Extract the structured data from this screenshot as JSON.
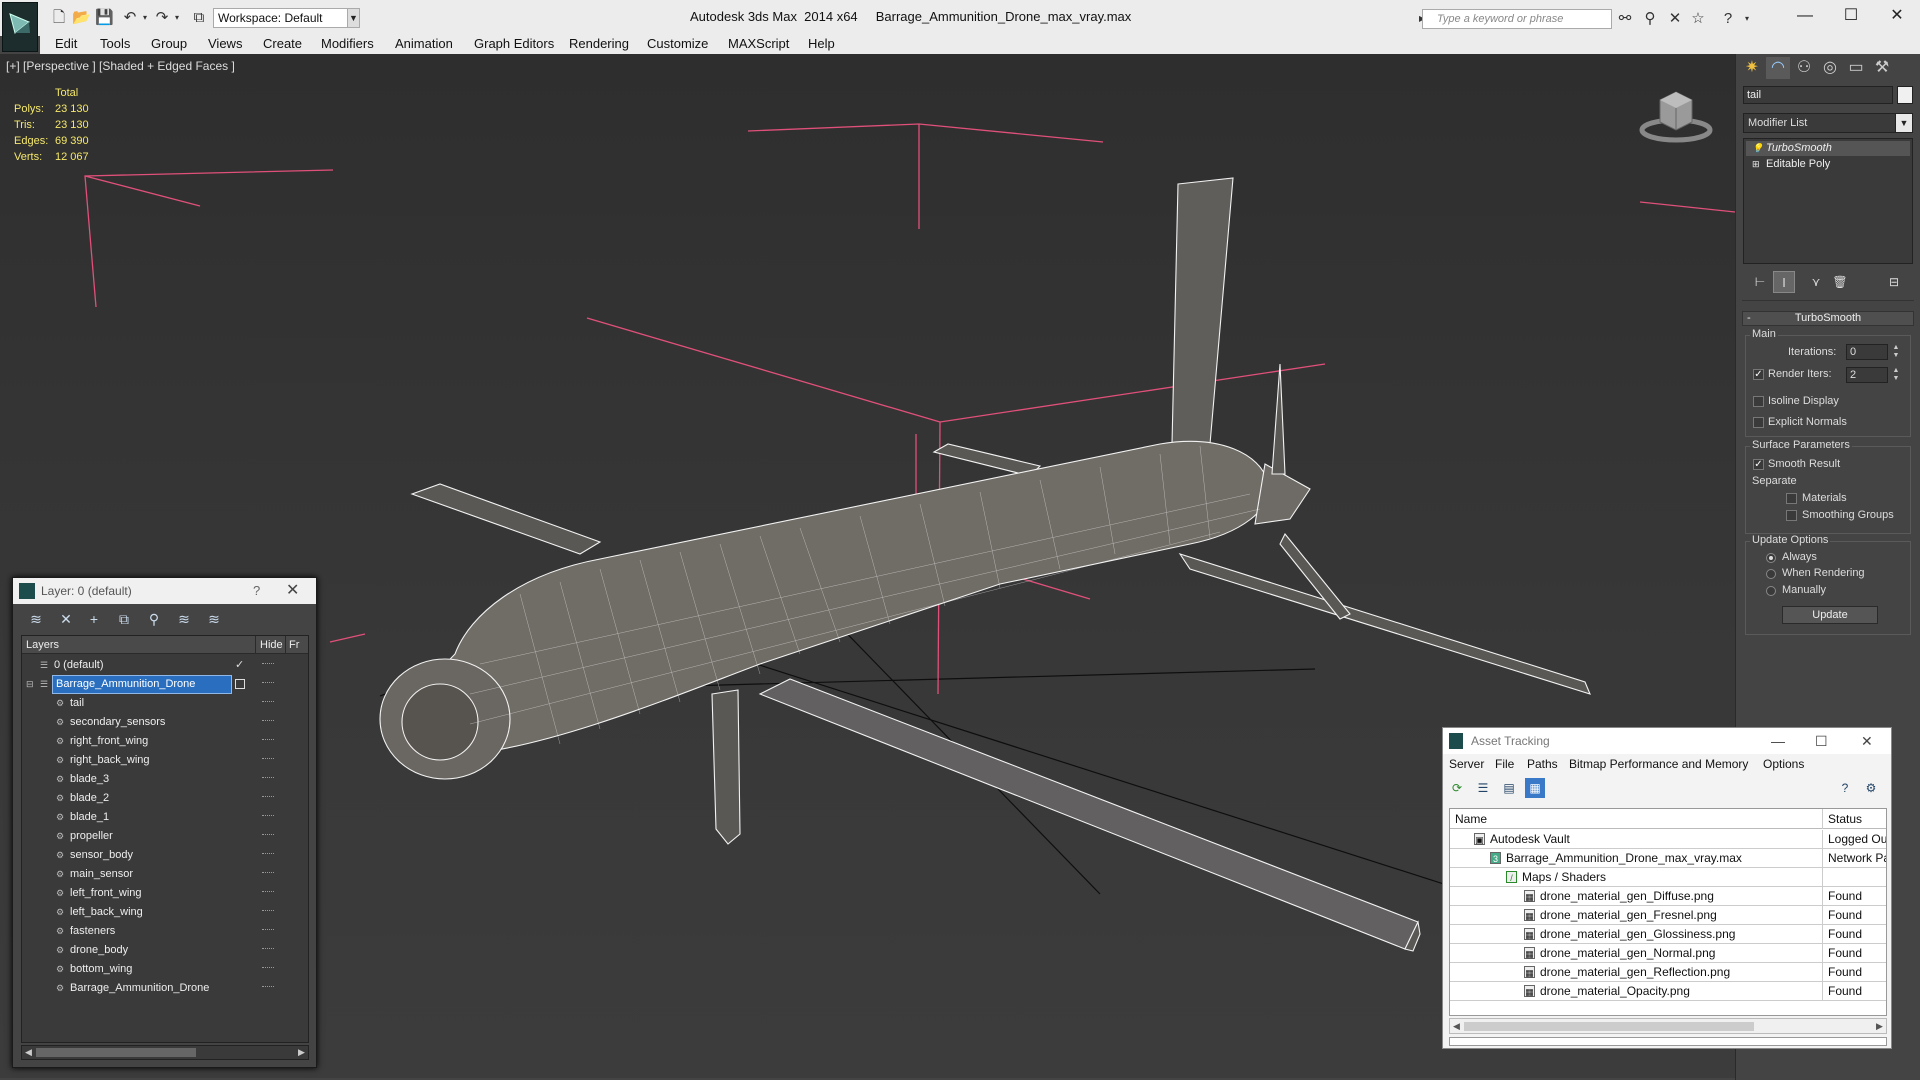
{
  "titlebar": {
    "workspace": "Workspace: Default",
    "app_title": "Autodesk 3ds Max  2014 x64",
    "file_name": "Barrage_Ammunition_Drone_max_vray.max",
    "search_placeholder": "Type a keyword or phrase"
  },
  "menu": [
    "Edit",
    "Tools",
    "Group",
    "Views",
    "Create",
    "Modifiers",
    "Animation",
    "Graph Editors",
    "Rendering",
    "Customize",
    "MAXScript",
    "Help"
  ],
  "viewport": {
    "label": "[+] [Perspective ] [Shaded + Edged Faces ]",
    "stats": {
      "header": "Total",
      "rows": [
        {
          "key": "Polys:",
          "value": "23 130"
        },
        {
          "key": "Tris:",
          "value": "23 130"
        },
        {
          "key": "Edges:",
          "value": "69 390"
        },
        {
          "key": "Verts:",
          "value": "12 067"
        }
      ]
    }
  },
  "command_panel": {
    "object_name": "tail",
    "modifier_list": "Modifier List",
    "stack": [
      "TurboSmooth",
      "Editable Poly"
    ],
    "rollout_title": "TurboSmooth",
    "main_group": "Main",
    "iterations_label": "Iterations:",
    "iterations_value": "0",
    "render_iters_label": "Render Iters:",
    "render_iters_value": "2",
    "render_iters_checked": true,
    "isoline_label": "Isoline Display",
    "explicit_normals_label": "Explicit Normals",
    "surface_group": "Surface Parameters",
    "smooth_result_label": "Smooth Result",
    "separate_label": "Separate",
    "materials_label": "Materials",
    "smoothing_groups_label": "Smoothing Groups",
    "update_group": "Update Options",
    "always_label": "Always",
    "when_rendering_label": "When Rendering",
    "manually_label": "Manually",
    "update_button": "Update"
  },
  "layer_window": {
    "title": "Layer: 0 (default)",
    "help": "?",
    "col_layers": "Layers",
    "col_hide": "Hide",
    "col_freeze": "Fr",
    "rows": [
      {
        "name": "0 (default)",
        "level": 0,
        "type": "layer"
      },
      {
        "name": "Barrage_Ammunition_Drone",
        "level": 0,
        "type": "layer",
        "selected": true
      },
      {
        "name": "tail",
        "level": 1,
        "type": "object"
      },
      {
        "name": "secondary_sensors",
        "level": 1,
        "type": "object"
      },
      {
        "name": "right_front_wing",
        "level": 1,
        "type": "object"
      },
      {
        "name": "right_back_wing",
        "level": 1,
        "type": "object"
      },
      {
        "name": "blade_3",
        "level": 1,
        "type": "object"
      },
      {
        "name": "blade_2",
        "level": 1,
        "type": "object"
      },
      {
        "name": "blade_1",
        "level": 1,
        "type": "object"
      },
      {
        "name": "propeller",
        "level": 1,
        "type": "object"
      },
      {
        "name": "sensor_body",
        "level": 1,
        "type": "object"
      },
      {
        "name": "main_sensor",
        "level": 1,
        "type": "object"
      },
      {
        "name": "left_front_wing",
        "level": 1,
        "type": "object"
      },
      {
        "name": "left_back_wing",
        "level": 1,
        "type": "object"
      },
      {
        "name": "fasteners",
        "level": 1,
        "type": "object"
      },
      {
        "name": "drone_body",
        "level": 1,
        "type": "object"
      },
      {
        "name": "bottom_wing",
        "level": 1,
        "type": "object"
      },
      {
        "name": "Barrage_Ammunition_Drone",
        "level": 1,
        "type": "object"
      }
    ]
  },
  "asset_window": {
    "title": "Asset Tracking",
    "menu": [
      "Server",
      "File",
      "Paths",
      "Bitmap Performance and Memory",
      "Options"
    ],
    "col_name": "Name",
    "col_status": "Status",
    "rows": [
      {
        "name": "Autodesk Vault",
        "status": "Logged Out",
        "level": 0
      },
      {
        "name": "Barrage_Ammunition_Drone_max_vray.max",
        "status": "Network Path",
        "level": 1
      },
      {
        "name": "Maps / Shaders",
        "status": "",
        "level": 2
      },
      {
        "name": "drone_material_gen_Diffuse.png",
        "status": "Found",
        "level": 3
      },
      {
        "name": "drone_material_gen_Fresnel.png",
        "status": "Found",
        "level": 3
      },
      {
        "name": "drone_material_gen_Glossiness.png",
        "status": "Found",
        "level": 3
      },
      {
        "name": "drone_material_gen_Normal.png",
        "status": "Found",
        "level": 3
      },
      {
        "name": "drone_material_gen_Reflection.png",
        "status": "Found",
        "level": 3
      },
      {
        "name": "drone_material_Opacity.png",
        "status": "Found",
        "level": 3
      }
    ]
  },
  "colors": {
    "accent_selection": "#2a6fbf",
    "stats_text": "#f5e86a",
    "grid_line": "#000000",
    "bbox_line": "#e0507a",
    "wireframe": "#f2f2f2"
  }
}
